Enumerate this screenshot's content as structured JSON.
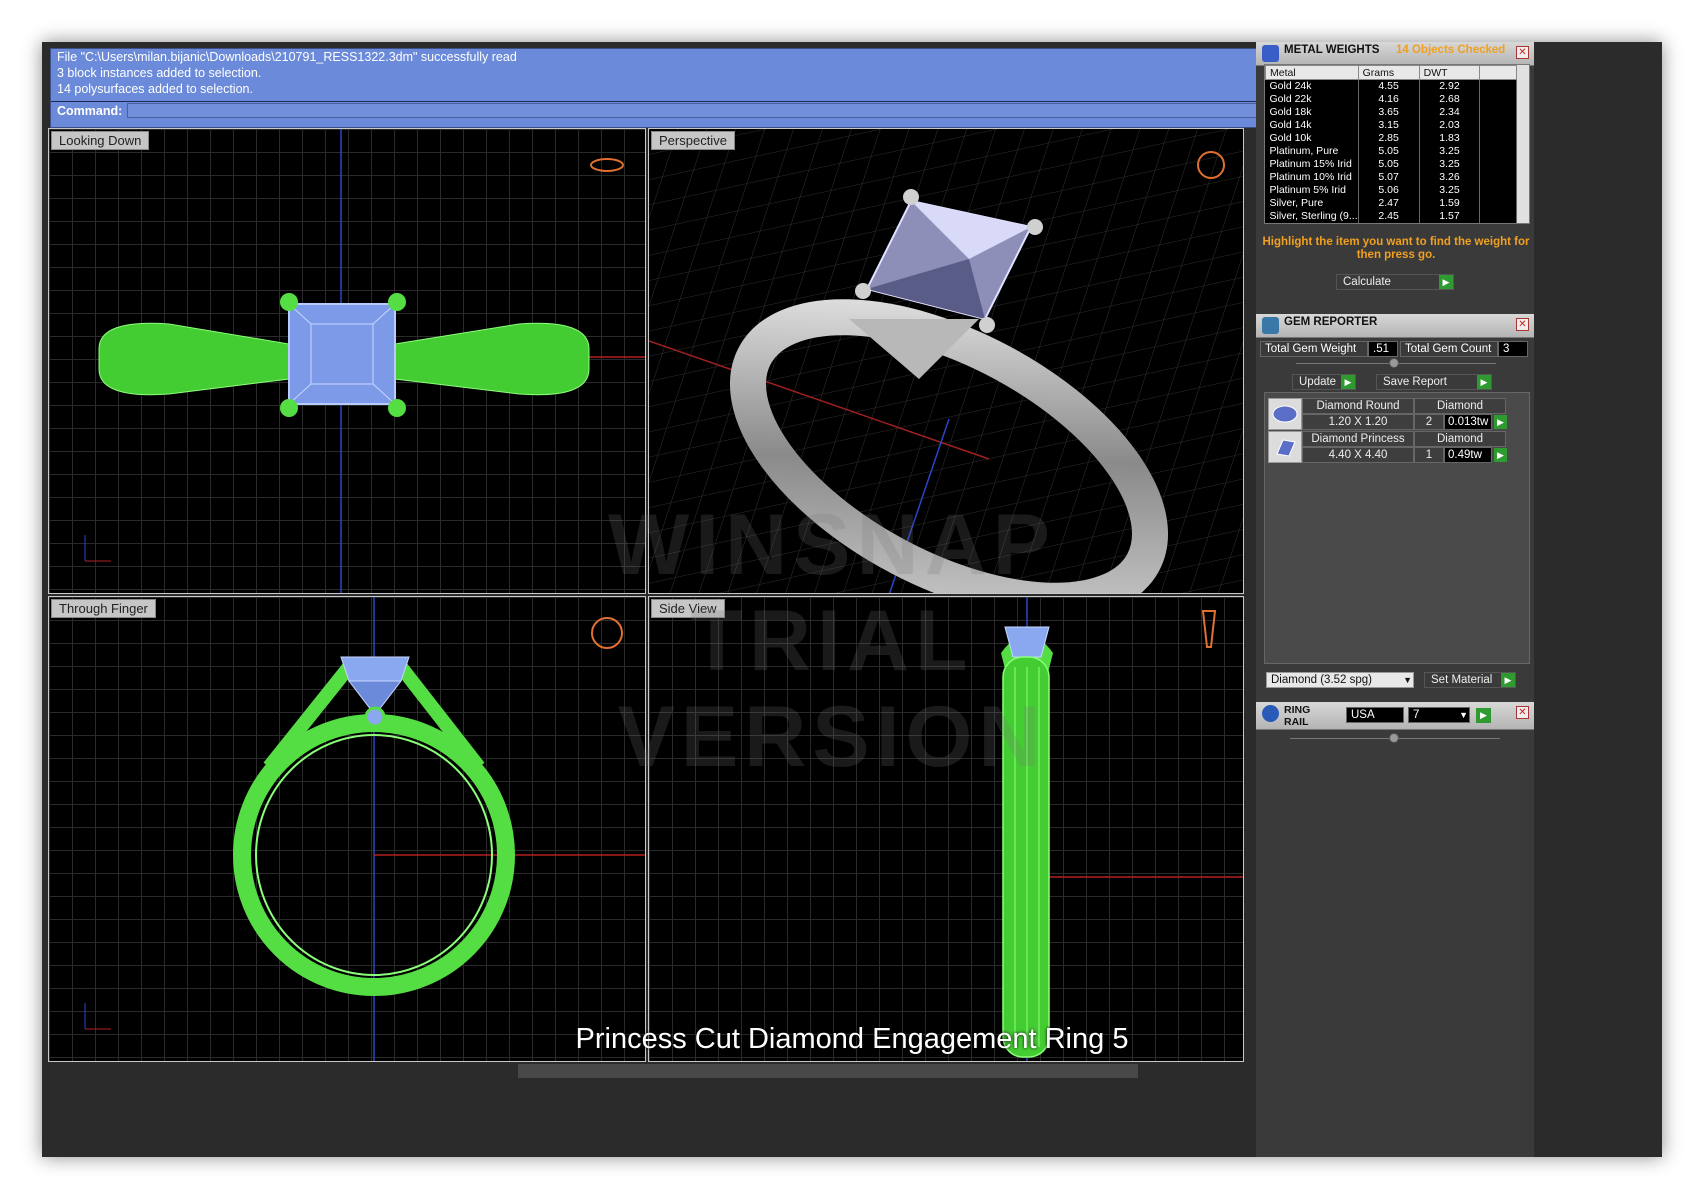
{
  "command": {
    "lines": [
      "File \"C:\\Users\\milan.bijanic\\Downloads\\210791_RESS1322.3dm\" successfully read",
      "3 block instances added to selection.",
      "14 polysurfaces added to selection."
    ],
    "label": "Command:"
  },
  "viewports": {
    "top": "Looking Down",
    "perspective": "Perspective",
    "front": "Through Finger",
    "side": "Side View"
  },
  "caption": "Princess Cut Diamond Engagement Ring  5",
  "watermark": [
    "WINSNAP",
    "TRIAL VERSION"
  ],
  "metal_weights": {
    "title": "METAL WEIGHTS",
    "status": "14 Objects Checked",
    "columns": [
      "Metal",
      "Grams",
      "DWT"
    ],
    "rows": [
      [
        "Gold 24k",
        "4.55",
        "2.92"
      ],
      [
        "Gold 22k",
        "4.16",
        "2.68"
      ],
      [
        "Gold 18k",
        "3.65",
        "2.34"
      ],
      [
        "Gold 14k",
        "3.15",
        "2.03"
      ],
      [
        "Gold 10k",
        "2.85",
        "1.83"
      ],
      [
        "Platinum, Pure",
        "5.05",
        "3.25"
      ],
      [
        "Platinum 15% Irid",
        "5.05",
        "3.25"
      ],
      [
        "Platinum 10% Irid",
        "5.07",
        "3.26"
      ],
      [
        "Platinum 5% Irid",
        "5.06",
        "3.25"
      ],
      [
        "Silver, Pure",
        "2.47",
        "1.59"
      ],
      [
        "Silver, Sterling (9...",
        "2.45",
        "1.57"
      ]
    ],
    "note": "Highlight the item you want to find the weight for then press go.",
    "calculate_label": "Calculate"
  },
  "gem_reporter": {
    "title": "GEM REPORTER",
    "total_weight_label": "Total Gem Weight",
    "total_weight_value": ".51",
    "total_count_label": "Total Gem Count",
    "total_count_value": "3",
    "update_label": "Update",
    "save_label": "Save Report",
    "gems": [
      {
        "name": "Diamond Round",
        "type": "Diamond",
        "size": "1.20 X 1.20",
        "count": "2",
        "weight": "0.013tw"
      },
      {
        "name": "Diamond Princess",
        "type": "Diamond",
        "size": "4.40 X 4.40",
        "count": "1",
        "weight": "0.49tw"
      }
    ],
    "material_select": "Diamond    (3.52 spg)",
    "set_material_label": "Set Material"
  },
  "ring_rail": {
    "title": "RING RAIL",
    "country": "USA",
    "size": "7"
  },
  "colors": {
    "command_bg": "#6b8ad9",
    "wireframe": "#66ee55",
    "gem": "#8aa8f0",
    "accent_orange": "#f0a020",
    "go_green": "#2f9a2f"
  }
}
